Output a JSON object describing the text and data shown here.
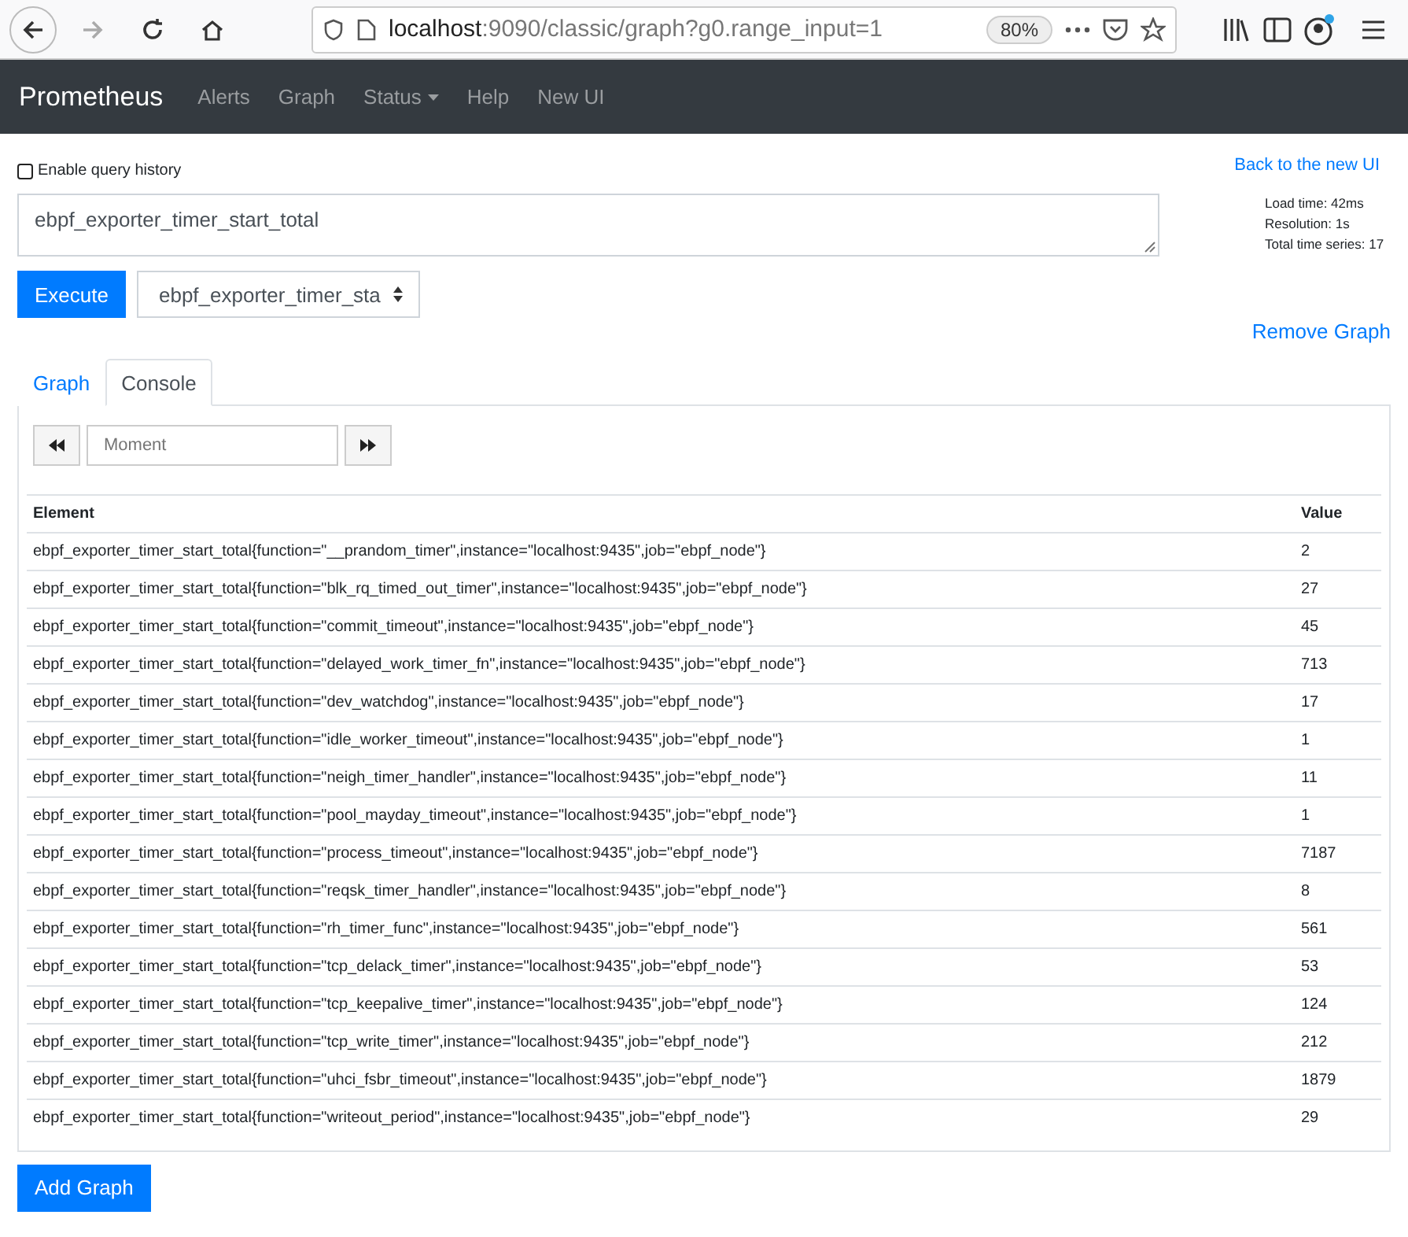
{
  "browser": {
    "url_host": "localhost",
    "url_rest": ":9090/classic/graph?g0.range_input=1",
    "zoom": "80%"
  },
  "navbar": {
    "brand": "Prometheus",
    "items": [
      {
        "label": "Alerts",
        "dropdown": false
      },
      {
        "label": "Graph",
        "dropdown": false
      },
      {
        "label": "Status",
        "dropdown": true
      },
      {
        "label": "Help",
        "dropdown": false
      },
      {
        "label": "New UI",
        "dropdown": false
      }
    ]
  },
  "query_history": {
    "label": "Enable query history",
    "checked": false
  },
  "back_link": "Back to the new UI",
  "expression": "ebpf_exporter_timer_start_total",
  "stats": [
    "Load time: 42ms",
    "Resolution: 1s",
    "Total time series: 17"
  ],
  "execute": "Execute",
  "metric_select": "ebpf_exporter_timer_sta",
  "remove_graph": "Remove Graph",
  "tabs": [
    {
      "label": "Graph",
      "selected": false
    },
    {
      "label": "Console",
      "selected": true
    }
  ],
  "moment": {
    "placeholder": "Moment"
  },
  "table": {
    "columns": [
      "Element",
      "Value"
    ],
    "rows": [
      [
        "ebpf_exporter_timer_start_total{function=\"__prandom_timer\",instance=\"localhost:9435\",job=\"ebpf_node\"}",
        "2"
      ],
      [
        "ebpf_exporter_timer_start_total{function=\"blk_rq_timed_out_timer\",instance=\"localhost:9435\",job=\"ebpf_node\"}",
        "27"
      ],
      [
        "ebpf_exporter_timer_start_total{function=\"commit_timeout\",instance=\"localhost:9435\",job=\"ebpf_node\"}",
        "45"
      ],
      [
        "ebpf_exporter_timer_start_total{function=\"delayed_work_timer_fn\",instance=\"localhost:9435\",job=\"ebpf_node\"}",
        "713"
      ],
      [
        "ebpf_exporter_timer_start_total{function=\"dev_watchdog\",instance=\"localhost:9435\",job=\"ebpf_node\"}",
        "17"
      ],
      [
        "ebpf_exporter_timer_start_total{function=\"idle_worker_timeout\",instance=\"localhost:9435\",job=\"ebpf_node\"}",
        "1"
      ],
      [
        "ebpf_exporter_timer_start_total{function=\"neigh_timer_handler\",instance=\"localhost:9435\",job=\"ebpf_node\"}",
        "11"
      ],
      [
        "ebpf_exporter_timer_start_total{function=\"pool_mayday_timeout\",instance=\"localhost:9435\",job=\"ebpf_node\"}",
        "1"
      ],
      [
        "ebpf_exporter_timer_start_total{function=\"process_timeout\",instance=\"localhost:9435\",job=\"ebpf_node\"}",
        "7187"
      ],
      [
        "ebpf_exporter_timer_start_total{function=\"reqsk_timer_handler\",instance=\"localhost:9435\",job=\"ebpf_node\"}",
        "8"
      ],
      [
        "ebpf_exporter_timer_start_total{function=\"rh_timer_func\",instance=\"localhost:9435\",job=\"ebpf_node\"}",
        "561"
      ],
      [
        "ebpf_exporter_timer_start_total{function=\"tcp_delack_timer\",instance=\"localhost:9435\",job=\"ebpf_node\"}",
        "53"
      ],
      [
        "ebpf_exporter_timer_start_total{function=\"tcp_keepalive_timer\",instance=\"localhost:9435\",job=\"ebpf_node\"}",
        "124"
      ],
      [
        "ebpf_exporter_timer_start_total{function=\"tcp_write_timer\",instance=\"localhost:9435\",job=\"ebpf_node\"}",
        "212"
      ],
      [
        "ebpf_exporter_timer_start_total{function=\"uhci_fsbr_timeout\",instance=\"localhost:9435\",job=\"ebpf_node\"}",
        "1879"
      ],
      [
        "ebpf_exporter_timer_start_total{function=\"writeout_period\",instance=\"localhost:9435\",job=\"ebpf_node\"}",
        "29"
      ]
    ]
  },
  "add_graph": "Add Graph"
}
